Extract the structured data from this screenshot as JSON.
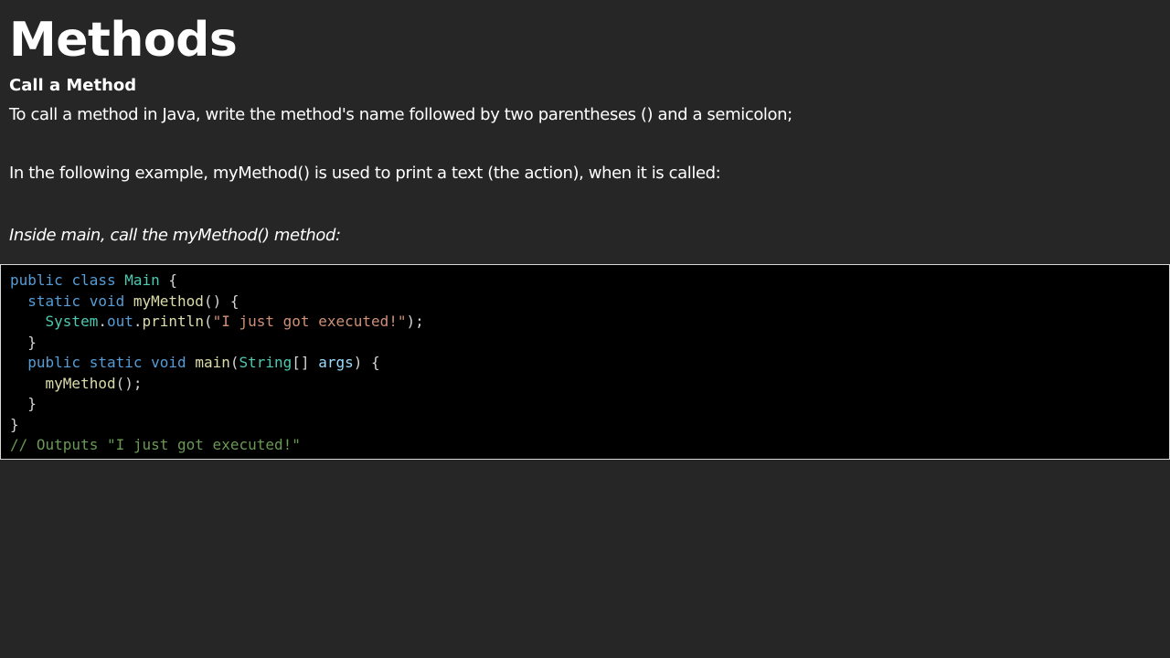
{
  "heading": "Methods",
  "subheading": "Call a Method",
  "paragraph_1": "To call a method in Java, write the method's name followed by two parentheses () and a semicolon;",
  "paragraph_2": "In the following example, myMethod() is used to print a text (the action), when it is called:",
  "example_caption": "Inside main, call the myMethod() method:",
  "code": {
    "line1": {
      "kw1": "public",
      "kw2": "class",
      "cls": "Main",
      "brace": "{"
    },
    "line2": {
      "kw1": "static",
      "kw2": "void",
      "fn": "myMethod",
      "rest": "() {"
    },
    "line3": {
      "obj": "System",
      "dot1": ".",
      "field": "out",
      "dot2": ".",
      "fn": "println",
      "open": "(",
      "str": "\"I just got executed!\"",
      "close": ");"
    },
    "line4": "}",
    "line5": {
      "kw1": "public",
      "kw2": "static",
      "kw3": "void",
      "fn": "main",
      "open": "(",
      "type": "String",
      "brackets": "[]",
      "param": "args",
      "close": ") {"
    },
    "line6": {
      "fn": "myMethod",
      "rest": "();"
    },
    "line7": "}",
    "line8": "}",
    "line9": "// Outputs \"I just got executed!\""
  },
  "colors": {
    "background": "#262626",
    "code_background": "#000000",
    "keyword": "#569cd6",
    "type": "#4ec9b0",
    "function": "#dcdcaa",
    "string": "#ce9178",
    "comment": "#6a9955",
    "variable": "#9cdcfe"
  }
}
